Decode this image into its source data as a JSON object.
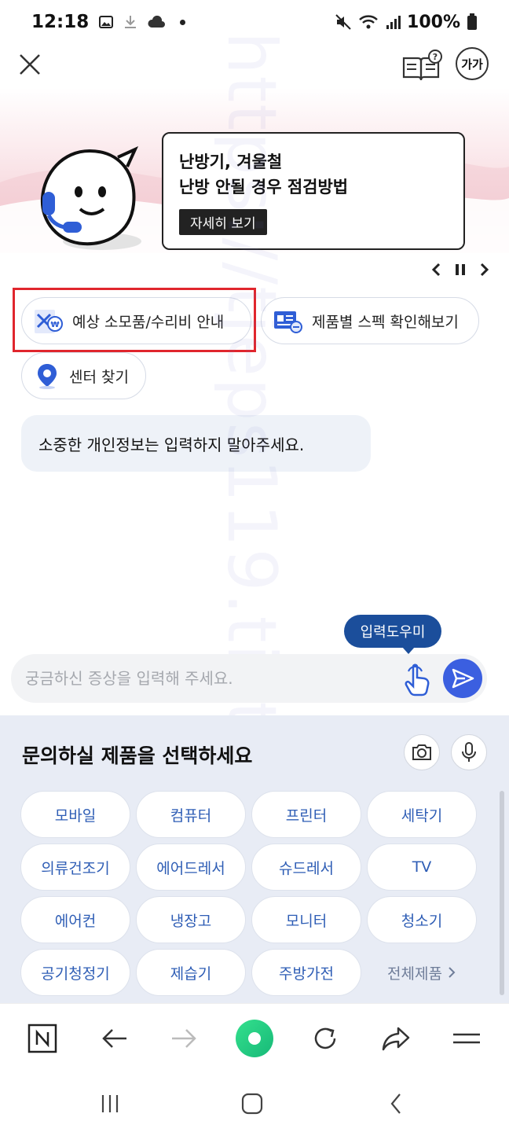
{
  "status_bar": {
    "time": "12:18",
    "battery": "100%"
  },
  "header": {
    "font_size_label": "가가"
  },
  "banner": {
    "line1": "난방기, 겨울철",
    "line2": "난방 안될 경우 점검방법",
    "more_label": "자세히 보기"
  },
  "quick_menu": [
    {
      "label": "예상 소모품/수리비 안내"
    },
    {
      "label": "제품별 스펙 확인해보기"
    },
    {
      "label": "센터 찾기"
    }
  ],
  "notice": "소중한 개인정보는 입력하지 말아주세요.",
  "input": {
    "helper_tip": "입력도우미",
    "placeholder": "궁금하신 증상을 입력해 주세요."
  },
  "products": {
    "title": "문의하실 제품을 선택하세요",
    "items": [
      "모바일",
      "컴퓨터",
      "프린터",
      "세탁기",
      "의류건조기",
      "에어드레서",
      "슈드레서",
      "TV",
      "에어컨",
      "냉장고",
      "모니터",
      "청소기",
      "공기청정기",
      "제습기",
      "주방가전"
    ],
    "all_label": "전체제품"
  },
  "watermark": "https://tjeps119.tistory.com",
  "colors": {
    "accent": "#3b5fe0",
    "helper_tip_bg": "#1b4e9b",
    "product_text": "#2e5db5",
    "highlight_box": "#e0262d"
  }
}
